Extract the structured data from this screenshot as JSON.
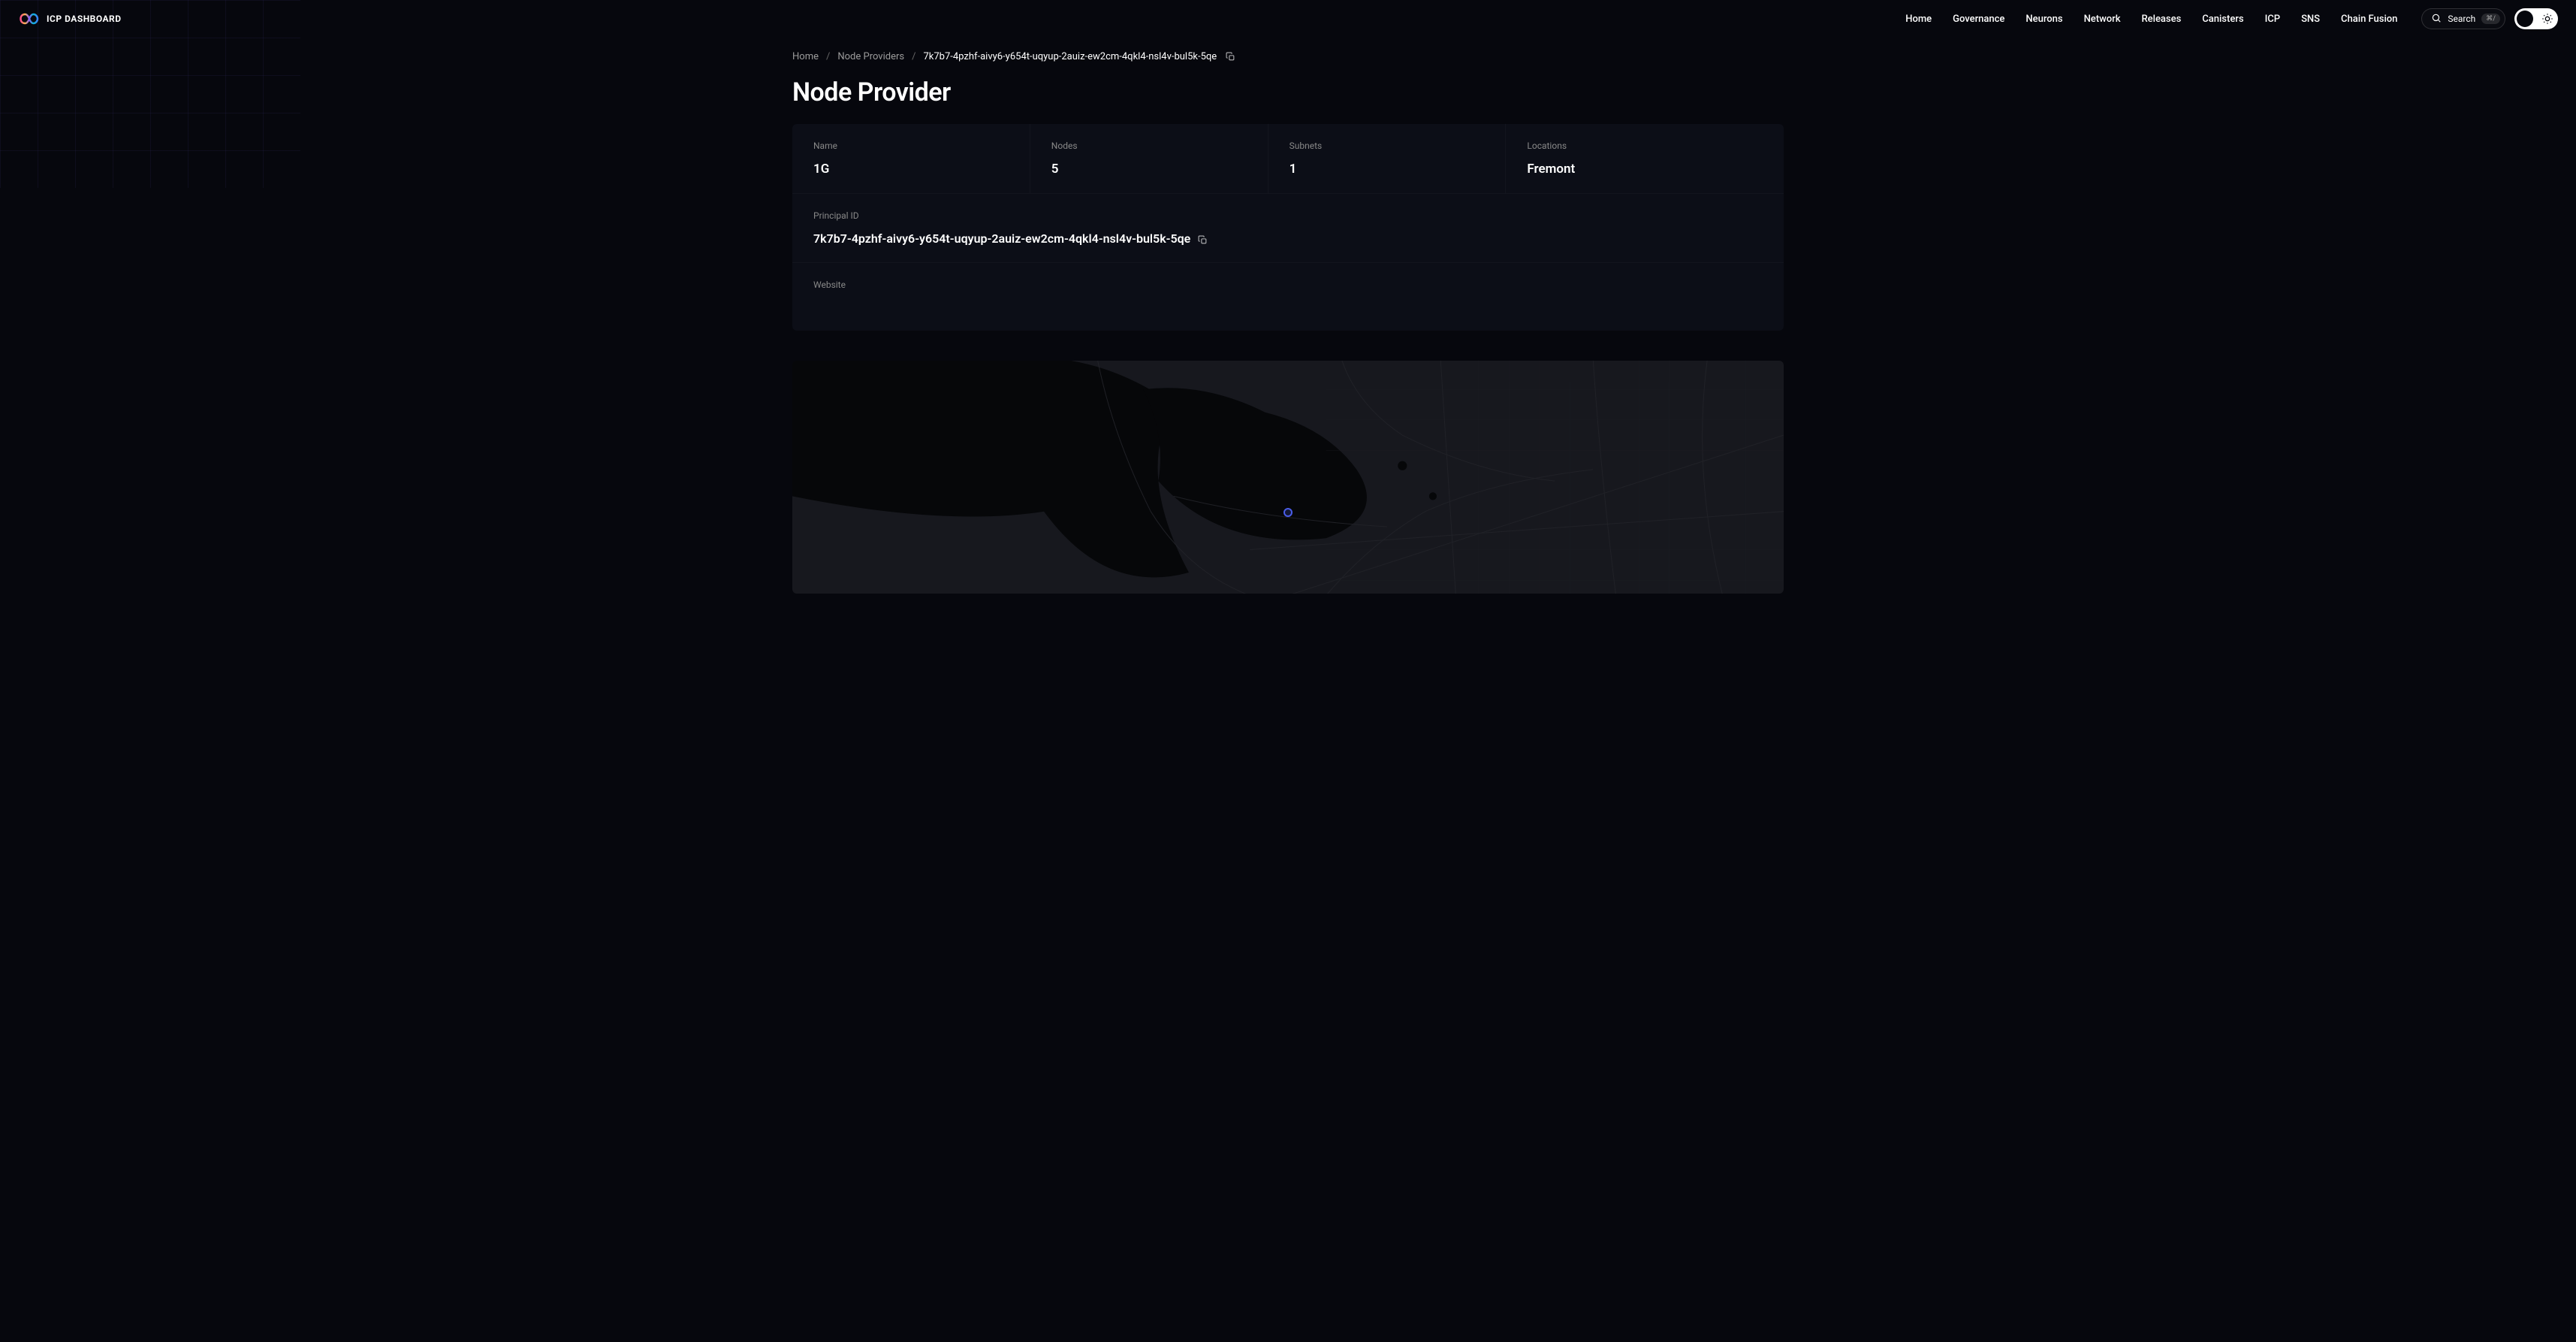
{
  "header": {
    "logo_text": "ICP DASHBOARD",
    "nav": [
      "Home",
      "Governance",
      "Neurons",
      "Network",
      "Releases",
      "Canisters",
      "ICP",
      "SNS",
      "Chain Fusion"
    ],
    "search_label": "Search",
    "search_kbd": "⌘/"
  },
  "breadcrumb": {
    "items": [
      {
        "label": "Home"
      },
      {
        "label": "Node Providers"
      }
    ],
    "current": "7k7b7-4pzhf-aivy6-y654t-uqyup-2auiz-ew2cm-4qkl4-nsl4v-bul5k-5qe"
  },
  "page_title": "Node Provider",
  "details": {
    "name_label": "Name",
    "name_value": "1G",
    "nodes_label": "Nodes",
    "nodes_value": "5",
    "subnets_label": "Subnets",
    "subnets_value": "1",
    "locations_label": "Locations",
    "locations_value": "Fremont",
    "principal_label": "Principal ID",
    "principal_value": "7k7b7-4pzhf-aivy6-y654t-uqyup-2auiz-ew2cm-4qkl4-nsl4v-bul5k-5qe",
    "website_label": "Website",
    "website_value": ""
  }
}
